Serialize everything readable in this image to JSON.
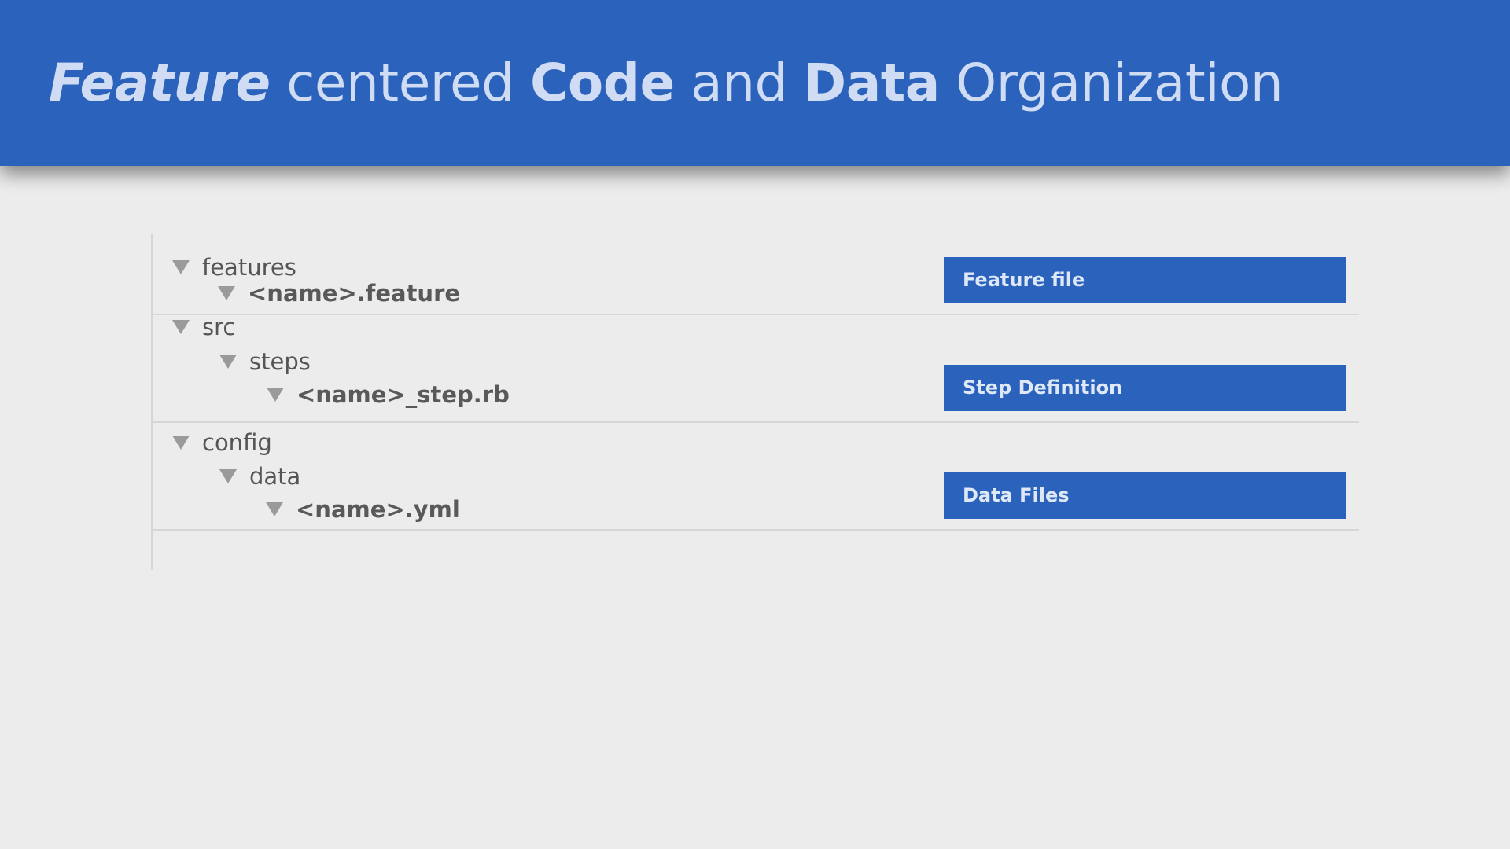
{
  "slide": {
    "title": {
      "part1": "Feature",
      "part2": " centered ",
      "part3": "Code",
      "part4": " and ",
      "part5": "Data",
      "part6": " Organization"
    },
    "tree": {
      "features": "features",
      "feature_file": "<name>.feature",
      "src": "src",
      "steps": "steps",
      "step_file": "<name>_step.rb",
      "config": "config",
      "data": "data",
      "data_file": "<name>.yml"
    },
    "tags": {
      "feature": "Feature file",
      "step": "Step Definition",
      "data": "Data Files"
    },
    "colors": {
      "accent": "#2b63bc",
      "background": "#ececec",
      "title_text": "#cfdcf3"
    },
    "icons": {
      "expand": "triangle-down-icon"
    }
  }
}
